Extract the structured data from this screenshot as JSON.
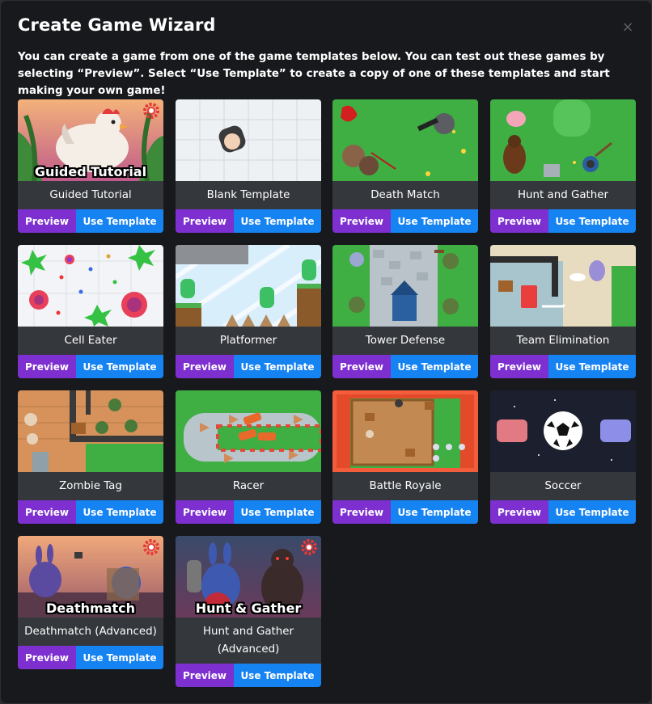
{
  "title": "Create Game Wizard",
  "close_glyph": "×",
  "description": "You can create a game from one of the game templates below. You can test out these games by selecting “Preview”. Select “Use Template” to create a copy of one of these templates and start making your own game!",
  "buttons": {
    "preview": "Preview",
    "use": "Use Template"
  },
  "templates": [
    {
      "name": "Guided Tutorial",
      "overlay": "Guided Tutorial"
    },
    {
      "name": "Blank Template"
    },
    {
      "name": "Death Match"
    },
    {
      "name": "Hunt and Gather"
    },
    {
      "name": "Cell Eater"
    },
    {
      "name": "Platformer"
    },
    {
      "name": "Tower Defense"
    },
    {
      "name": "Team Elimination"
    },
    {
      "name": "Zombie Tag"
    },
    {
      "name": "Racer"
    },
    {
      "name": "Battle Royale"
    },
    {
      "name": "Soccer"
    },
    {
      "name": "Deathmatch (Advanced)",
      "overlay": "Deathmatch"
    },
    {
      "name": "Hunt and Gather (Advanced)",
      "overlay": "Hunt & Gather"
    }
  ],
  "colors": {
    "preview": "#7d2fd0",
    "use": "#1683f3",
    "card": "#34373c",
    "modal": "#17191c"
  }
}
